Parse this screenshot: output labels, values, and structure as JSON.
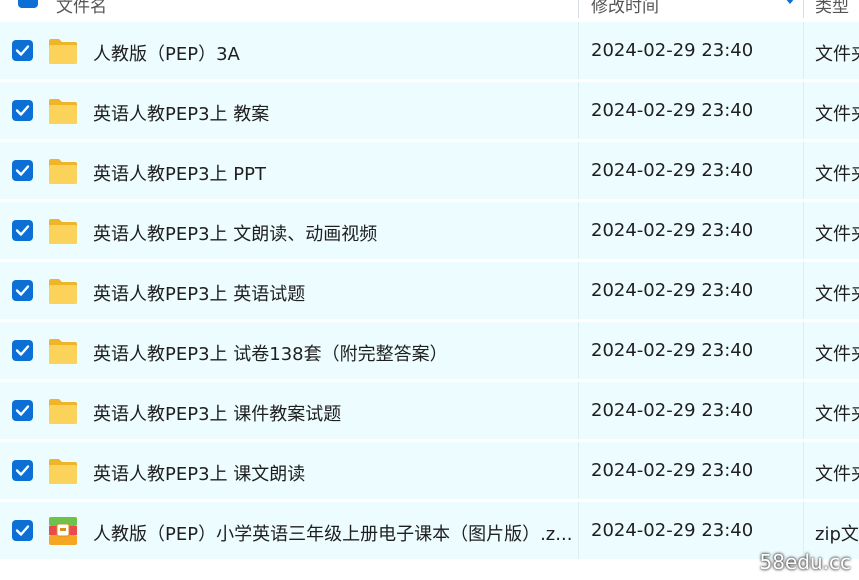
{
  "header": {
    "name_label": "文件名",
    "date_label": "修改时间",
    "type_label": "类型"
  },
  "files": [
    {
      "name": "人教版（PEP）3A",
      "date": "2024-02-29 23:40",
      "type": "文件夹",
      "icon": "folder",
      "checked": true
    },
    {
      "name": "英语人教PEP3上 教案",
      "date": "2024-02-29 23:40",
      "type": "文件夹",
      "icon": "folder",
      "checked": true
    },
    {
      "name": "英语人教PEP3上 PPT",
      "date": "2024-02-29 23:40",
      "type": "文件夹",
      "icon": "folder",
      "checked": true
    },
    {
      "name": "英语人教PEP3上 文朗读、动画视频",
      "date": "2024-02-29 23:40",
      "type": "文件夹",
      "icon": "folder",
      "checked": true
    },
    {
      "name": "英语人教PEP3上 英语试题",
      "date": "2024-02-29 23:40",
      "type": "文件夹",
      "icon": "folder",
      "checked": true
    },
    {
      "name": "英语人教PEP3上 试卷138套（附完整答案）",
      "date": "2024-02-29 23:40",
      "type": "文件夹",
      "icon": "folder",
      "checked": true
    },
    {
      "name": "英语人教PEP3上 课件教案试题",
      "date": "2024-02-29 23:40",
      "type": "文件夹",
      "icon": "folder",
      "checked": true
    },
    {
      "name": "英语人教PEP3上 课文朗读",
      "date": "2024-02-29 23:40",
      "type": "文件夹",
      "icon": "folder",
      "checked": true
    },
    {
      "name": "人教版（PEP）小学英语三年级上册电子课本（图片版）.z...",
      "date": "2024-02-29 23:40",
      "type": "zip文",
      "icon": "zip",
      "checked": true
    }
  ],
  "watermark": "58edu.cc",
  "colors": {
    "accent": "#0b6fd6",
    "row_bg": "#ecfcff",
    "folder": "#f7c948"
  }
}
